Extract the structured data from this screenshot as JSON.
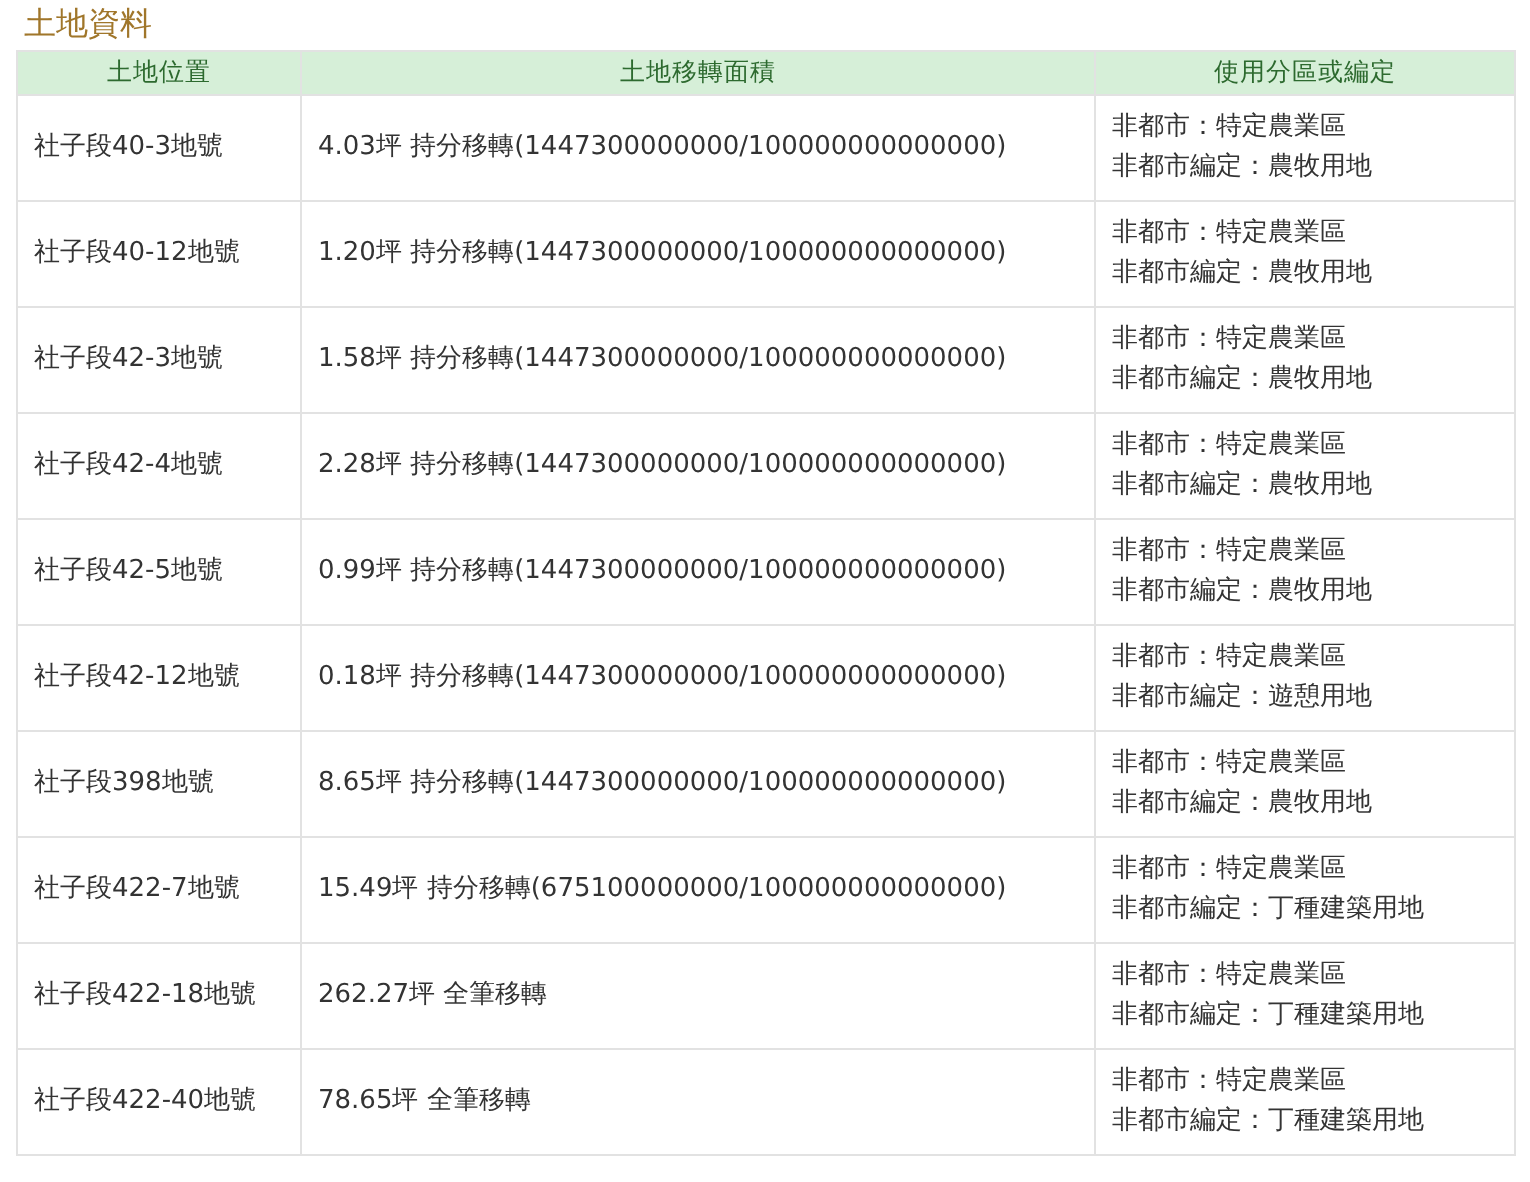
{
  "section_title": "土地資料",
  "table": {
    "columns": [
      "土地位置",
      "土地移轉面積",
      "使用分區或編定"
    ],
    "rows": [
      {
        "location": "社子段40-3地號",
        "area": "4.03坪 持分移轉(1447300000000/100000000000000)",
        "zoning": [
          "非都市：特定農業區",
          "非都市編定：農牧用地"
        ]
      },
      {
        "location": "社子段40-12地號",
        "area": "1.20坪 持分移轉(1447300000000/100000000000000)",
        "zoning": [
          "非都市：特定農業區",
          "非都市編定：農牧用地"
        ]
      },
      {
        "location": "社子段42-3地號",
        "area": "1.58坪 持分移轉(1447300000000/100000000000000)",
        "zoning": [
          "非都市：特定農業區",
          "非都市編定：農牧用地"
        ]
      },
      {
        "location": "社子段42-4地號",
        "area": "2.28坪 持分移轉(1447300000000/100000000000000)",
        "zoning": [
          "非都市：特定農業區",
          "非都市編定：農牧用地"
        ]
      },
      {
        "location": "社子段42-5地號",
        "area": "0.99坪 持分移轉(1447300000000/100000000000000)",
        "zoning": [
          "非都市：特定農業區",
          "非都市編定：農牧用地"
        ]
      },
      {
        "location": "社子段42-12地號",
        "area": "0.18坪 持分移轉(1447300000000/100000000000000)",
        "zoning": [
          "非都市：特定農業區",
          "非都市編定：遊憩用地"
        ]
      },
      {
        "location": "社子段398地號",
        "area": "8.65坪 持分移轉(1447300000000/100000000000000)",
        "zoning": [
          "非都市：特定農業區",
          "非都市編定：農牧用地"
        ]
      },
      {
        "location": "社子段422-7地號",
        "area": "15.49坪 持分移轉(675100000000/100000000000000)",
        "zoning": [
          "非都市：特定農業區",
          "非都市編定：丁種建築用地"
        ]
      },
      {
        "location": "社子段422-18地號",
        "area": "262.27坪 全筆移轉",
        "zoning": [
          "非都市：特定農業區",
          "非都市編定：丁種建築用地"
        ]
      },
      {
        "location": "社子段422-40地號",
        "area": "78.65坪 全筆移轉",
        "zoning": [
          "非都市：特定農業區",
          "非都市編定：丁種建築用地"
        ]
      }
    ]
  }
}
